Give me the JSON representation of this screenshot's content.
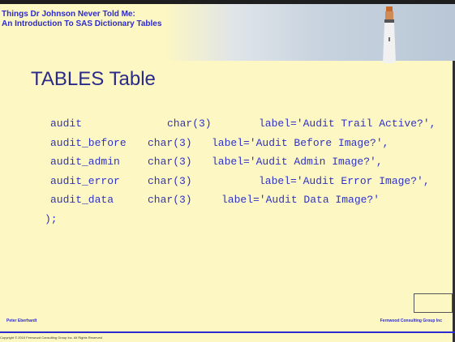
{
  "header": {
    "deck_title_line1": "Things Dr Johnson Never Told Me:",
    "deck_title_line2": "An Introduction To SAS Dictionary Tables"
  },
  "slide": {
    "title": "TABLES Table",
    "code_lines": [
      {
        "name": "audit",
        "type": "char(3)",
        "label": "label='Audit Trail Active?',"
      },
      {
        "name": "audit_before",
        "type": "char(3)",
        "label": "label='Audit Before Image?',"
      },
      {
        "name": "audit_admin",
        "type": "char(3)",
        "label": "label='Audit Admin Image?',"
      },
      {
        "name": "audit_error",
        "type": "char(3)",
        "label": "label='Audit Error Image?',"
      },
      {
        "name": "audit_data",
        "type": "char(3)",
        "label": "label='Audit Data Image?'"
      }
    ],
    "closing": ");"
  },
  "footer": {
    "author": "Peter Eberhardt",
    "company": "Fernwood Consulting Group Inc",
    "copyright": "Copyright © 2010 Fernwood Consulting Group Inc. All Rights Reserved"
  }
}
